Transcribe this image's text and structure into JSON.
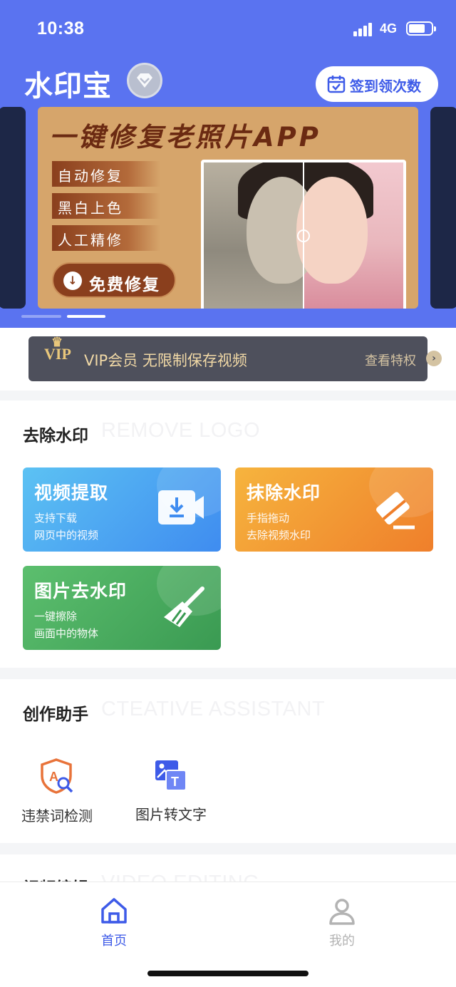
{
  "status_bar": {
    "time": "10:38",
    "network": "4G"
  },
  "header": {
    "app_title": "水印宝",
    "checkin_label": "签到领次数"
  },
  "banner": {
    "headline": "一键修复老照片APP",
    "tags": [
      "自动修复",
      "黑白上色",
      "人工精修"
    ],
    "cta_label": "免费修复"
  },
  "vip_bar": {
    "text": "VIP会员 无限制保存视频",
    "link_label": "查看特权",
    "badge": "VIP"
  },
  "remove_section": {
    "title": "去除水印",
    "subtitle": "REMOVE LOGO",
    "tiles": [
      {
        "title": "视频提取",
        "line1": "支持下载",
        "line2": "网页中的视频",
        "icon": "video-download-icon"
      },
      {
        "title": "抹除水印",
        "line1": "手指拖动",
        "line2": "去除视频水印",
        "icon": "eraser-icon"
      },
      {
        "title": "图片去水印",
        "line1": "一键擦除",
        "line2": "画面中的物体",
        "icon": "broom-icon"
      }
    ]
  },
  "assistant_section": {
    "title": "创作助手",
    "subtitle": "CTEATIVE ASSISTANT",
    "tools": [
      {
        "label": "违禁词检测",
        "icon": "shield-search-icon"
      },
      {
        "label": "图片转文字",
        "icon": "image-to-text-icon"
      }
    ]
  },
  "editing_section": {
    "title": "视频编辑",
    "subtitle": "VIDEO EDITING"
  },
  "tabbar": {
    "tabs": [
      {
        "label": "首页",
        "icon": "home-icon",
        "active": true
      },
      {
        "label": "我的",
        "icon": "user-icon",
        "active": false
      }
    ]
  },
  "colors": {
    "brand": "#5a73f0",
    "tab_active": "#3e5be8",
    "tab_inactive": "#b3b3b3"
  }
}
